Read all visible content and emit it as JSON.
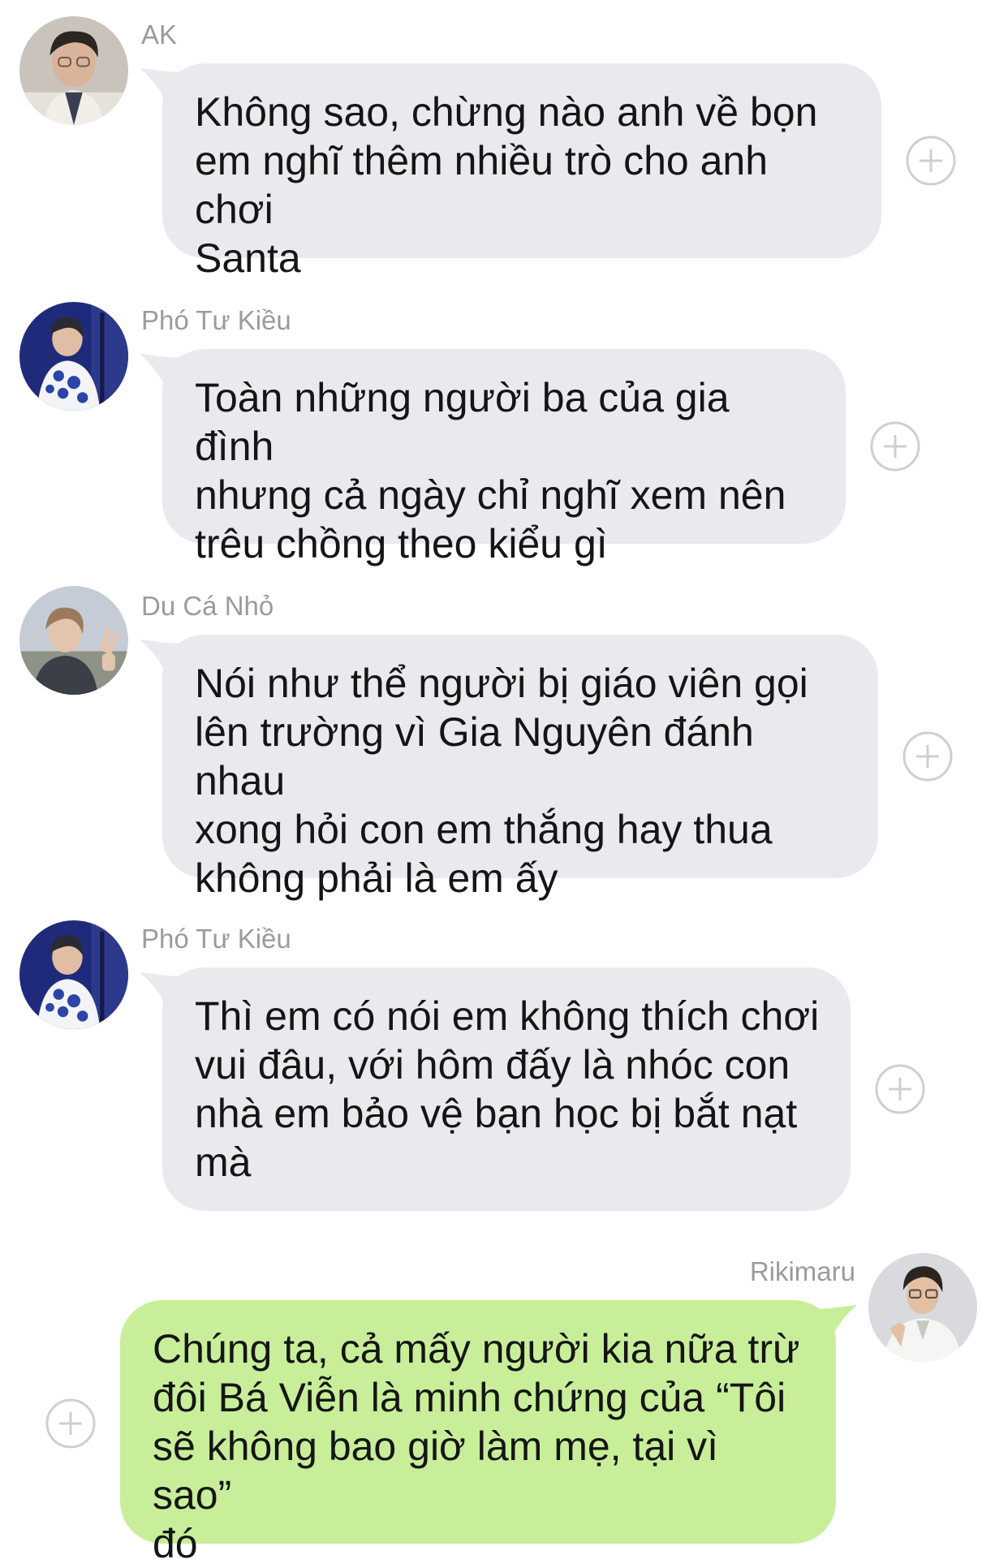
{
  "colors": {
    "incoming_bubble": "#e9eaee",
    "outgoing_bubble": "#c8ee9a",
    "sender_name": "#9b9b9b",
    "plus_icon": "#cfcfcf"
  },
  "messages": [
    {
      "sender": "AK",
      "direction": "incoming",
      "text": "Không sao, chừng nào anh về bọn\nem nghĩ thêm nhiều trò cho anh chơi\nSanta",
      "action_icon": "plus-circle-icon"
    },
    {
      "sender": "Phó Tư Kiều",
      "direction": "incoming",
      "text": "Toàn những người ba của gia đình\nnhưng cả ngày chỉ nghĩ xem nên\ntrêu chồng theo kiểu gì",
      "action_icon": "plus-circle-icon"
    },
    {
      "sender": "Du Cá Nhỏ",
      "direction": "incoming",
      "text": "Nói như thể người bị giáo viên gọi\nlên trường vì Gia Nguyên đánh nhau\nxong hỏi con em thắng hay thua\nkhông phải là em ấy",
      "action_icon": "plus-circle-icon"
    },
    {
      "sender": "Phó Tư Kiều",
      "direction": "incoming",
      "text": "Thì em có nói em không thích chơi\nvui đâu, với hôm đấy là nhóc con\nnhà em bảo vệ bạn học bị bắt nạt\nmà",
      "action_icon": "plus-circle-icon"
    },
    {
      "sender": "Rikimaru",
      "direction": "outgoing",
      "text": "Chúng ta, cả mấy người kia nữa trừ\nđôi Bá Viễn là minh chứng của “Tôi\nsẽ không bao giờ làm mẹ, tại vì sao”\nđó",
      "action_icon": "plus-circle-icon"
    }
  ]
}
